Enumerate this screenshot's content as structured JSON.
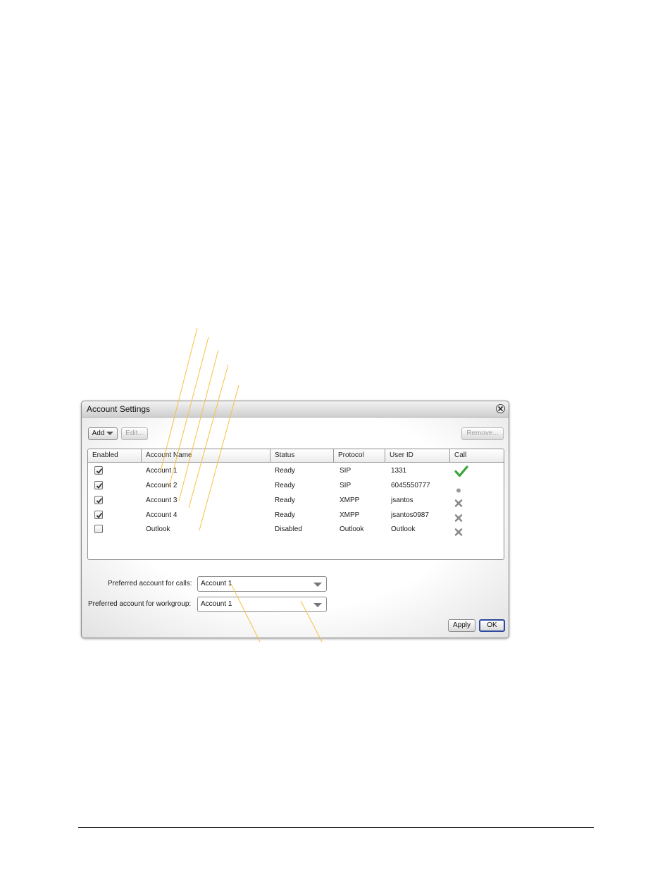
{
  "window": {
    "title": "Account Settings"
  },
  "toolbar": {
    "add_label": "Add",
    "edit_label": "Edit...",
    "remove_label": "Remove..."
  },
  "table": {
    "columns": [
      "Enabled",
      "Account Name",
      "Status",
      "Protocol",
      "User ID",
      "Call"
    ],
    "rows": [
      {
        "enabled": true,
        "name": "Account 1",
        "status": "Ready",
        "protocol": "SIP",
        "user_id": "1331",
        "call": "check-icon"
      },
      {
        "enabled": true,
        "name": "Account 2",
        "status": "Ready",
        "protocol": "SIP",
        "user_id": "6045550777",
        "call": "dot-icon"
      },
      {
        "enabled": true,
        "name": "Account 3",
        "status": "Ready",
        "protocol": "XMPP",
        "user_id": "jsantos",
        "call": "cross-icon"
      },
      {
        "enabled": true,
        "name": "Account 4",
        "status": "Ready",
        "protocol": "XMPP",
        "user_id": "jsantos0987",
        "call": "cross-icon"
      },
      {
        "enabled": false,
        "name": "Outlook",
        "status": "Disabled",
        "protocol": "Outlook",
        "user_id": "Outlook",
        "call": "cross-icon"
      }
    ]
  },
  "preferences": {
    "calls_label": "Preferred account for calls:",
    "calls_value": "Account 1",
    "workgroup_label": "Preferred account for workgroup:",
    "workgroup_value": "Account 1"
  },
  "actions": {
    "apply_label": "Apply",
    "ok_label": "OK"
  },
  "colors": {
    "callout_line": "#f5c242",
    "check_green": "#3aa53a",
    "default_button_border": "#2e4a9e"
  }
}
